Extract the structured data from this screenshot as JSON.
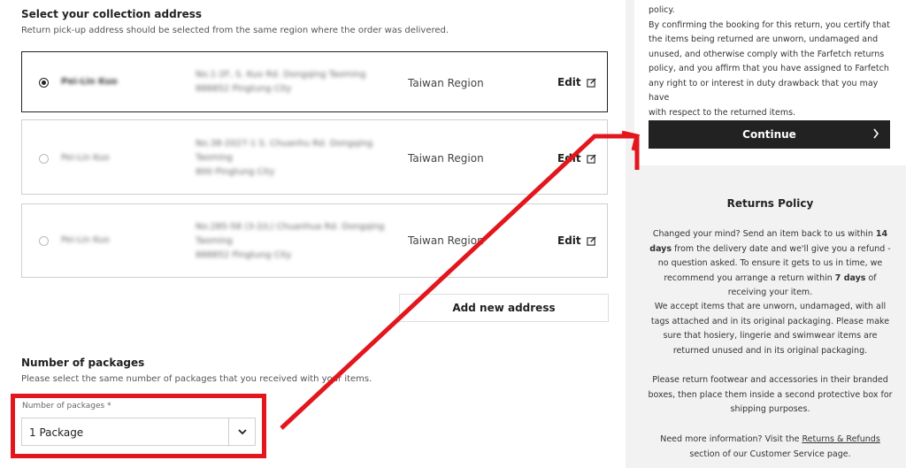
{
  "collection": {
    "title": "Select your collection address",
    "subtitle": "Return pick-up address should be selected from the same region where the order was delivered.",
    "addresses": [
      {
        "name": "Pei-Lin Kuo",
        "address_lines": [
          "No.1-2F, S. Kuo Rd. Dongqing Taoming",
          "888852 Pingtung City"
        ],
        "region": "Taiwan Region",
        "edit_label": "Edit",
        "selected": true
      },
      {
        "name": "Pei-Lin Kuo",
        "address_lines": [
          "No.38-2027-1 S. Chuanhu Rd. Dongqing",
          "Taoming",
          "800 Pingtung City"
        ],
        "region": "Taiwan Region",
        "edit_label": "Edit",
        "selected": false
      },
      {
        "name": "Pei-Lin Kuo",
        "address_lines": [
          "No.285-58 (3-2/L) Chuanhua Rd. Dongqing",
          "Taoming",
          "888852 Pingtung City"
        ],
        "region": "Taiwan Region",
        "edit_label": "Edit",
        "selected": false
      }
    ],
    "add_new_label": "Add new address"
  },
  "packages": {
    "title": "Number of packages",
    "subtitle": "Please select the same number of packages that you received with your items.",
    "field_label": "Number of packages *",
    "selected_value": "1 Package"
  },
  "sidebar": {
    "terms_lines": [
      "policy.",
      "By confirming the booking for this return, you certify that",
      "the items being returned are unworn, undamaged and",
      "unused, and otherwise comply with the Farfetch returns",
      "policy, and you affirm that you have assigned to Farfetch",
      "any right to or interest in duty drawback that you may have",
      "with respect to the returned items."
    ],
    "continue_label": "Continue"
  },
  "returns_policy": {
    "title": "Returns Policy",
    "p1_a": "Changed your mind? Send an item back to us within ",
    "p1_bold1": "14 days",
    "p1_b": " from the delivery date and we'll give you a refund - no question asked. To ensure it gets to us in time, we recommend you arrange a return within ",
    "p1_bold2": "7 days",
    "p1_c": " of receiving your item.",
    "p2": "We accept items that are unworn, undamaged, with all tags attached and in its original packaging. Please make sure that hosiery, lingerie and swimwear items are returned unused and in its original packaging.",
    "p3": "Please return footwear and accessories in their branded boxes, then place them inside a second protective box for shipping purposes.",
    "p4_a": "Need more information? Visit the ",
    "p4_link": "Returns & Refunds",
    "p4_b": " section of our Customer Service page."
  },
  "annotation": {
    "color": "#e3161d"
  }
}
